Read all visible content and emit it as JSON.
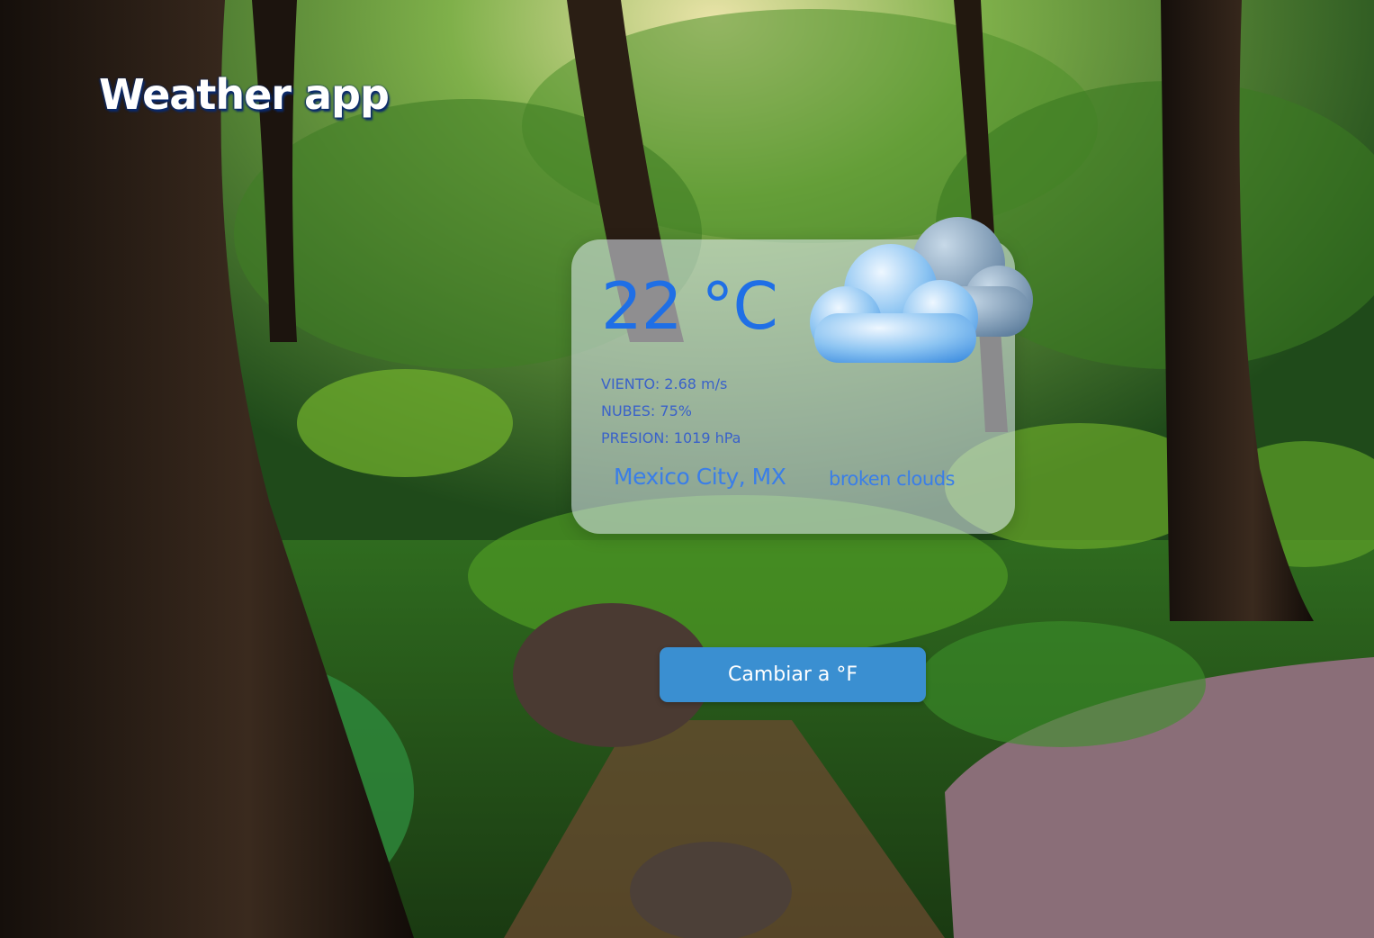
{
  "header": {
    "title": "Weather app"
  },
  "weather": {
    "temperature": "22 °C",
    "icon": "broken-clouds-icon",
    "wind": "VIENTO: 2.68 m/s",
    "clouds": "NUBES: 75%",
    "pressure": "PRESION: 1019 hPa",
    "location": "Mexico City, MX",
    "description": "broken clouds"
  },
  "controls": {
    "toggle_unit_label": "Cambiar a °F"
  },
  "colors": {
    "accent": "#1f6fe6",
    "button": "#3a8fd1",
    "text_secondary": "#3a62c9"
  }
}
